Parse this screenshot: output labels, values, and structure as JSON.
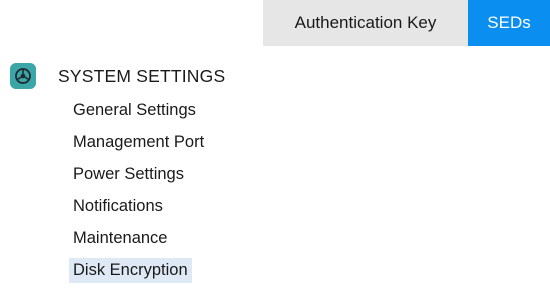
{
  "tabs": [
    {
      "label": "Authentication Key",
      "active": false
    },
    {
      "label": "SEDs",
      "active": true
    }
  ],
  "section": {
    "title": "SYSTEM SETTINGS",
    "icon": "settings-wheel-icon",
    "items": [
      {
        "label": "General Settings"
      },
      {
        "label": "Management Port"
      },
      {
        "label": "Power Settings"
      },
      {
        "label": "Notifications"
      },
      {
        "label": "Maintenance"
      },
      {
        "label": "Disk Encryption",
        "selected": true
      }
    ]
  },
  "colors": {
    "active_tab": "#0a8ef0",
    "inactive_tab": "#e6e6e6",
    "icon_bg": "#3aa6a8",
    "selected_item_bg": "#dfe9f6"
  }
}
